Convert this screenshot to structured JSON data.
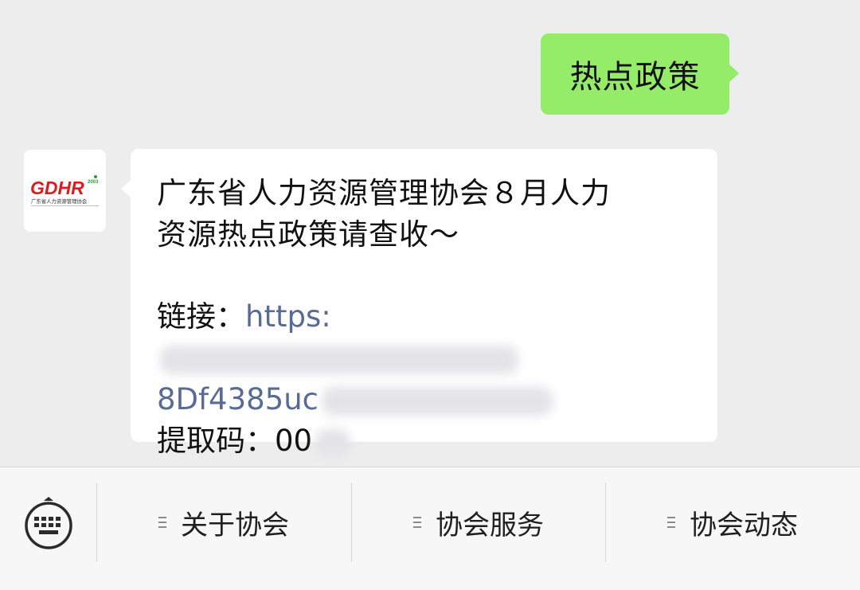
{
  "outgoing_message": {
    "text": "热点政策"
  },
  "avatar": {
    "logo_text": "GDHR",
    "logo_year": "2003",
    "logo_caption": "广东省人力资源管理协会",
    "brand_red": "#d81e1e",
    "brand_green": "#2f9a3a"
  },
  "incoming_message": {
    "title_line1": "广东省人力资源管理协会８月人力",
    "title_line2": "资源热点政策请查收～",
    "link_label": "链接：",
    "link_prefix": "https:",
    "link_line2": "8Df4385uc",
    "code_label": "提取码：",
    "code_value": "00"
  },
  "menu": {
    "items": [
      {
        "label": "关于协会"
      },
      {
        "label": "协会服务"
      },
      {
        "label": "协会动态"
      }
    ]
  },
  "colors": {
    "background": "#ededed",
    "bubble_out": "#95ec69",
    "bubble_in": "#ffffff",
    "link": "#576b95",
    "menu_bar": "#f7f7f7"
  }
}
